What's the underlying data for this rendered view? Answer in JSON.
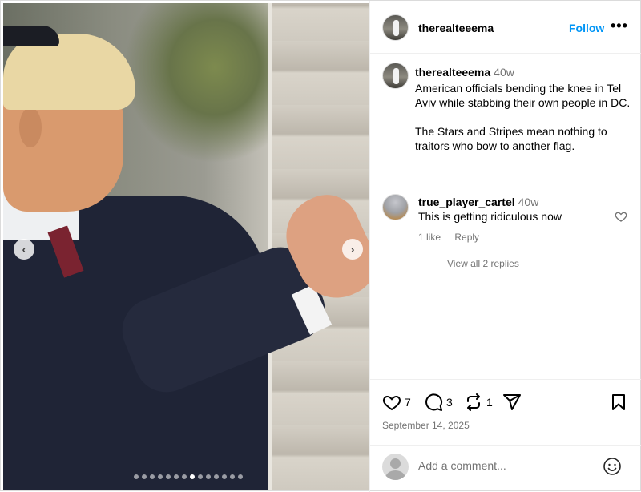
{
  "media": {
    "carousel_total": 14,
    "carousel_active_index": 8
  },
  "header": {
    "username": "therealteeema",
    "follow_label": "Follow",
    "more_label": "•••"
  },
  "caption": {
    "username": "therealteeema",
    "time": "40w",
    "text": "American officials bending the knee in Tel Aviv while stabbing their own people in DC.\n\nThe Stars and Stripes mean nothing to traitors who bow to another flag."
  },
  "comment": {
    "username": "true_player_cartel",
    "time": "40w",
    "text": "This is getting ridiculous now",
    "likes_label": "1 like",
    "reply_label": "Reply",
    "view_replies_label": "View all 2 replies"
  },
  "actions": {
    "like_count": "7",
    "comment_count": "3",
    "repost_count": "1",
    "date": "September 14, 2025"
  },
  "add_comment": {
    "placeholder": "Add a comment..."
  },
  "icons": {
    "prev": "chevron-left-icon",
    "next": "chevron-right-icon",
    "like": "heart-icon",
    "comment": "comment-bubble-icon",
    "repost": "repost-icon",
    "share": "paper-plane-icon",
    "save": "bookmark-icon",
    "emoji": "smiley-icon"
  },
  "colors": {
    "follow": "#0095f6",
    "muted": "#737373"
  }
}
